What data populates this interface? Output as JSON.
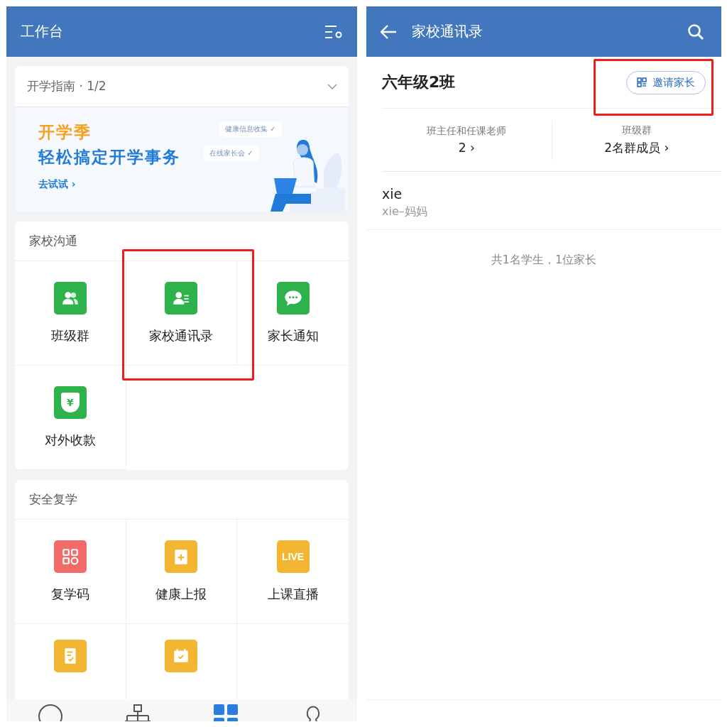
{
  "left": {
    "header": {
      "title": "工作台"
    },
    "guide": {
      "title": "开学指南 · 1/2",
      "expanded": false,
      "banner": {
        "headline": "开学季",
        "subtitle": "轻松搞定开学事务",
        "link": "去试试 ›",
        "bubbles": [
          "健康信息收集 ✓",
          "在线家长会 ✓"
        ]
      }
    },
    "sections": [
      {
        "title": "家校沟通",
        "items": [
          {
            "label": "班级群",
            "kind": "group",
            "color": "#2eb24b",
            "highlighted": false
          },
          {
            "label": "家校通讯录",
            "kind": "contact",
            "color": "#2eb24b",
            "highlighted": true
          },
          {
            "label": "家长通知",
            "kind": "chat",
            "color": "#2eb24b",
            "highlighted": false
          },
          {
            "label": "对外收款",
            "kind": "shield",
            "glyph": "¥",
            "color": "#2eb24b",
            "highlighted": false
          }
        ]
      },
      {
        "title": "安全复学",
        "items": [
          {
            "label": "复学码",
            "kind": "code",
            "color": "#f26b6b",
            "highlighted": false
          },
          {
            "label": "健康上报",
            "kind": "clipboard",
            "color": "#f2b632",
            "highlighted": false
          },
          {
            "label": "上课直播",
            "kind": "live",
            "glyph": "LIVE",
            "color": "#f2b632",
            "highlighted": false
          },
          {
            "kind": "doc",
            "color": "#f2b632",
            "highlighted": false
          },
          {
            "kind": "calendar",
            "color": "#f2b632",
            "highlighted": false
          }
        ]
      }
    ],
    "tab_bar": [
      {
        "kind": "chat",
        "selected": false
      },
      {
        "kind": "org",
        "selected": false
      },
      {
        "kind": "apps",
        "selected": true
      },
      {
        "kind": "person",
        "selected": false
      }
    ]
  },
  "right": {
    "header": {
      "title": "家校通讯录"
    },
    "class_name": "六年级2班",
    "invite": {
      "label": "邀请家长",
      "highlighted": true
    },
    "stats": [
      {
        "label": "班主任和任课老师",
        "value": "2 ›"
      },
      {
        "label": "班级群",
        "value": "2名群成员 ›"
      }
    ],
    "students": [
      {
        "name": "xie",
        "parent": "xie–妈妈"
      }
    ],
    "summary": "共1名学生，1位家长"
  }
}
